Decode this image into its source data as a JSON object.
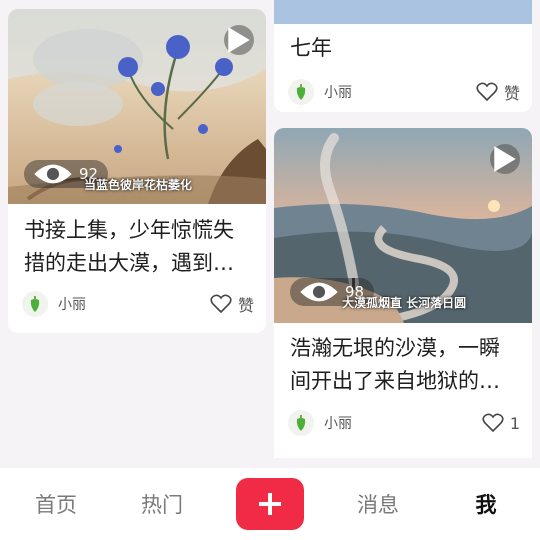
{
  "feed": {
    "left_card": {
      "views": "92",
      "caption": "当蓝色彼岸花枯萎化",
      "title": "书接上集，少年惊慌失措的走出大漠，遇到一个神秘人……",
      "author": "小丽",
      "like_label": "赞"
    },
    "right_top_card": {
      "title": "七年",
      "author": "小丽",
      "like_label": "赞"
    },
    "right_bottom_card": {
      "views": "98",
      "caption": "大漠孤烟直 长河落日圆",
      "title": "浩瀚无垠的沙漠，一瞬间开出了来自地狱的花朵……",
      "author": "小丽",
      "like_label": "1"
    }
  },
  "tabbar": {
    "home": "首页",
    "hot": "热门",
    "messages": "消息",
    "me": "我"
  },
  "colors": {
    "accent": "#f12b46",
    "background": "#f6f3f7",
    "avatar_icon": "#4caf3a"
  }
}
